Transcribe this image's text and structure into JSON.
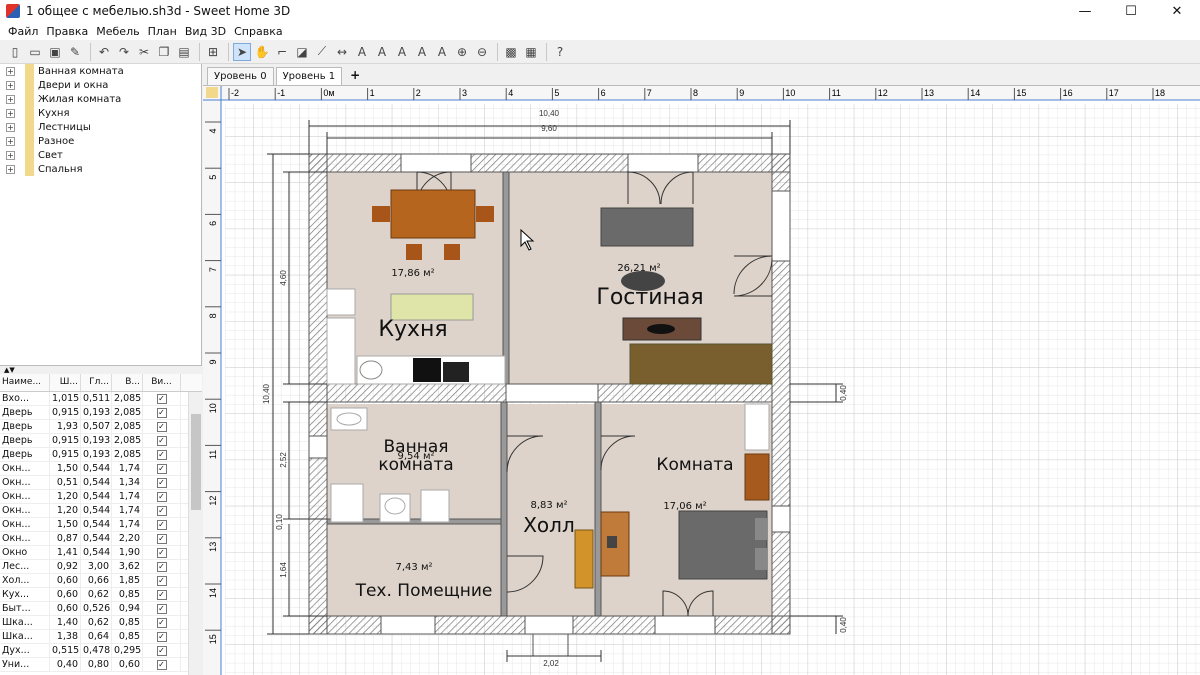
{
  "window": {
    "title": "1 общее с мебелью.sh3d - Sweet Home 3D",
    "min": "—",
    "max": "☐",
    "close": "✕"
  },
  "menu": [
    "Файл",
    "Правка",
    "Мебель",
    "План",
    "Вид 3D",
    "Справка"
  ],
  "categories": [
    "Ванная комната",
    "Двери и окна",
    "Жилая комната",
    "Кухня",
    "Лестницы",
    "Разное",
    "Свет",
    "Спальня"
  ],
  "furniture_table": {
    "headers": [
      "Наиме...",
      "Ш...",
      "Гл...",
      "В...",
      "Ви..."
    ],
    "rows": [
      [
        "Вхо...",
        "1,015",
        "0,511",
        "2,085"
      ],
      [
        "Дверь",
        "0,915",
        "0,193",
        "2,085"
      ],
      [
        "Дверь",
        "1,93",
        "0,507",
        "2,085"
      ],
      [
        "Дверь",
        "0,915",
        "0,193",
        "2,085"
      ],
      [
        "Дверь",
        "0,915",
        "0,193",
        "2,085"
      ],
      [
        "Окн...",
        "1,50",
        "0,544",
        "1,74"
      ],
      [
        "Окн...",
        "0,51",
        "0,544",
        "1,34"
      ],
      [
        "Окн...",
        "1,20",
        "0,544",
        "1,74"
      ],
      [
        "Окн...",
        "1,20",
        "0,544",
        "1,74"
      ],
      [
        "Окн...",
        "1,50",
        "0,544",
        "1,74"
      ],
      [
        "Окн...",
        "0,87",
        "0,544",
        "2,20"
      ],
      [
        "Окно",
        "1,41",
        "0,544",
        "1,90"
      ],
      [
        "Лес...",
        "0,92",
        "3,00",
        "3,62"
      ],
      [
        "Хол...",
        "0,60",
        "0,66",
        "1,85"
      ],
      [
        "Кух...",
        "0,60",
        "0,62",
        "0,85"
      ],
      [
        "Быт...",
        "0,60",
        "0,526",
        "0,94"
      ],
      [
        "Шка...",
        "1,40",
        "0,62",
        "0,85"
      ],
      [
        "Шка...",
        "1,38",
        "0,64",
        "0,85"
      ],
      [
        "Дух...",
        "0,515",
        "0,478",
        "0,295"
      ],
      [
        "Уни...",
        "0,40",
        "0,80",
        "0,60"
      ]
    ]
  },
  "levels": [
    "Уровень 0",
    "Уровень 1"
  ],
  "plus": "+",
  "ruler_h": [
    "-2",
    "-1",
    "0м",
    "1",
    "2",
    "3",
    "4",
    "5",
    "6",
    "7",
    "8",
    "9",
    "10",
    "11",
    "12",
    "13",
    "14",
    "15",
    "16",
    "17",
    "18"
  ],
  "ruler_v": [
    "4",
    "5",
    "6",
    "7",
    "8",
    "9",
    "10",
    "11",
    "12",
    "13",
    "14",
    "15"
  ],
  "rooms": {
    "kitchen": {
      "name": "Кухня",
      "area": "17,86 м²"
    },
    "living": {
      "name": "Гостиная",
      "area": "26,21 м²"
    },
    "bath_l1": "Ванная",
    "bath_l2": "комната",
    "bath_area": "9,54 м²",
    "hall": {
      "name": "Холл",
      "area": "8,83 м²"
    },
    "room": {
      "name": "Комната",
      "area": "17,06 м²"
    },
    "tech": {
      "name": "Тех. Помещние",
      "area": "7,43 м²"
    }
  },
  "dims": {
    "d1040": "10,40",
    "d960": "9,60",
    "d460": "4,60",
    "d1040v": "10,40",
    "d252": "2,52",
    "d010": "0,10",
    "d164": "1,64",
    "d040a": "0,40",
    "d040b": "0,40",
    "d202": "2,02"
  }
}
